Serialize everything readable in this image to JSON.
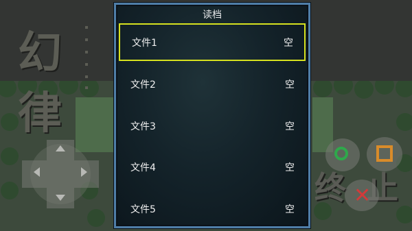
{
  "background": {
    "title_chars": [
      "幻",
      "律"
    ],
    "ending_chars": [
      "终",
      "止"
    ]
  },
  "dialog": {
    "title": "读档",
    "slots": [
      {
        "name": "文件1",
        "status": "空",
        "selected": true
      },
      {
        "name": "文件2",
        "status": "空",
        "selected": false
      },
      {
        "name": "文件3",
        "status": "空",
        "selected": false
      },
      {
        "name": "文件4",
        "status": "空",
        "selected": false
      },
      {
        "name": "文件5",
        "status": "空",
        "selected": false
      }
    ]
  },
  "controls": {
    "dpad": [
      "up",
      "down",
      "left",
      "right"
    ],
    "buttons": [
      {
        "symbol": "circle",
        "color": "#2fa84b"
      },
      {
        "symbol": "square",
        "color": "#d98b2a"
      },
      {
        "symbol": "cross",
        "color": "#d23a3a"
      }
    ]
  },
  "colors": {
    "selection": "#d7e21f",
    "dialog_border": "#4f7ea8"
  }
}
